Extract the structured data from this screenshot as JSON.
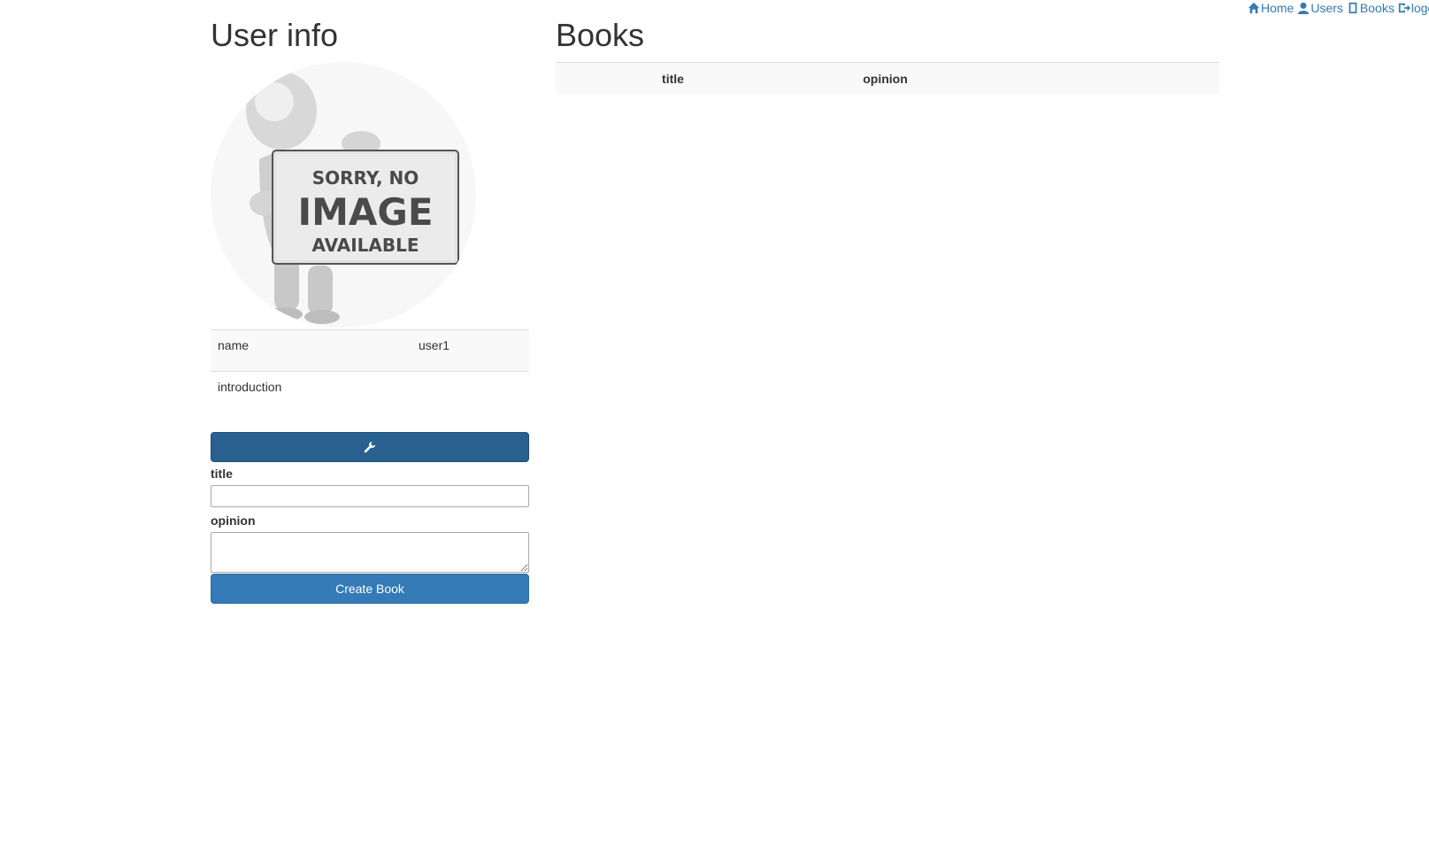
{
  "nav": {
    "home": "Home",
    "users": "Users",
    "books": "Books",
    "logout": "logo"
  },
  "user_info": {
    "heading": "User info",
    "avatar_text": {
      "line1": "SORRY, NO",
      "line2": "IMAGE",
      "line3": "AVAILABLE"
    },
    "rows": [
      {
        "key": "name",
        "value": "user1"
      },
      {
        "key": "introduction",
        "value": ""
      }
    ],
    "edit_icon": "wrench-icon"
  },
  "form": {
    "title_label": "title",
    "title_value": "",
    "opinion_label": "opinion",
    "opinion_value": "",
    "submit_label": "Create Book"
  },
  "books": {
    "heading": "Books",
    "columns": [
      "title",
      "opinion"
    ]
  },
  "colors": {
    "link": "#337ab7",
    "primary": "#337ab7",
    "primary_dark": "#286090"
  }
}
